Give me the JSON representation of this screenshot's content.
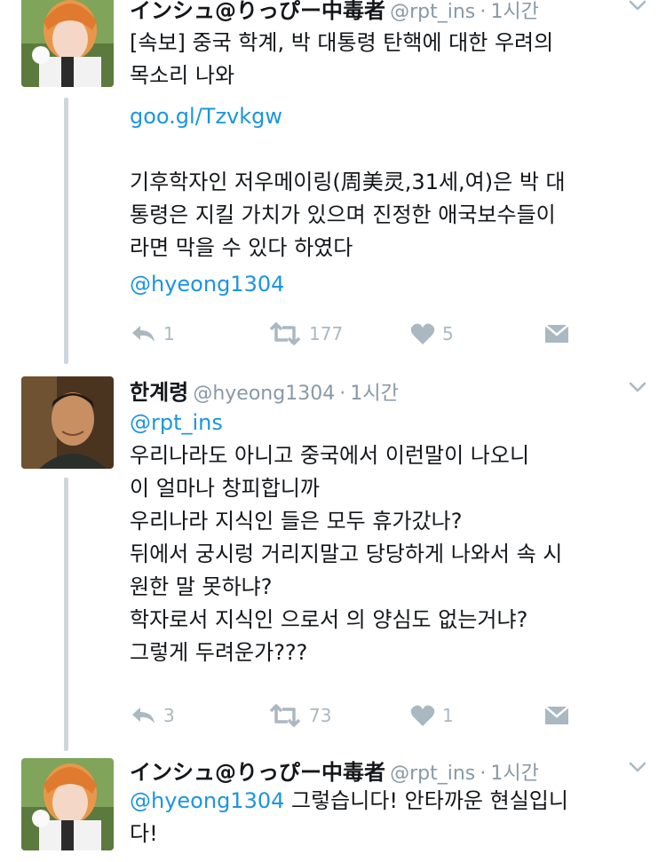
{
  "tweets": [
    {
      "name": "インシュ@りっぴー中毒者",
      "handle": "@rpt_ins",
      "sep": "·",
      "time": "1시간",
      "lines": [
        "[속보] 중국 학계, 박 대통령 탄핵에 대한 우려의",
        "목소리 나와"
      ],
      "link": "goo.gl/Tzvkgw",
      "lines2": [
        "기후학자인 저우메이링(周美灵,31세,여)은 박 대",
        "통령은 지킬 가치가 있으며 진정한 애국보수들이",
        "라면 막을 수 있다 하였다"
      ],
      "mention": "@hyeong1304",
      "reply_count": "1",
      "retweet_count": "177",
      "like_count": "5"
    },
    {
      "name": "한계령",
      "handle": "@hyeong1304",
      "sep": "·",
      "time": "1시간",
      "mention": "@rpt_ins",
      "lines": [
        "우리나라도 아니고 중국에서 이런말이 나오니",
        "이 얼마나 창피합니까",
        "우리나라 지식인 들은 모두 휴가갔나?",
        "뒤에서 궁시렁 거리지말고 당당하게 나와서 속 시",
        "원한 말 못하냐?",
        "학자로서 지식인 으로서 의 양심도 없는거냐?",
        "그렇게 두려운가???"
      ],
      "reply_count": "3",
      "retweet_count": "73",
      "like_count": "1"
    },
    {
      "name": "インシュ@りっぴー中毒者",
      "handle": "@rpt_ins",
      "sep": "·",
      "time": "1시간",
      "mention": "@hyeong1304",
      "line1_rest": " 그렇습니다! 안타까운 현실입니",
      "line2": "다!"
    }
  ],
  "colors": {
    "link": "#1b95e0",
    "action": "#aab8c2",
    "thread": "#ccd6dd"
  },
  "icons": [
    "reply-icon",
    "retweet-icon",
    "like-icon",
    "dm-icon",
    "chevron-down-icon"
  ]
}
